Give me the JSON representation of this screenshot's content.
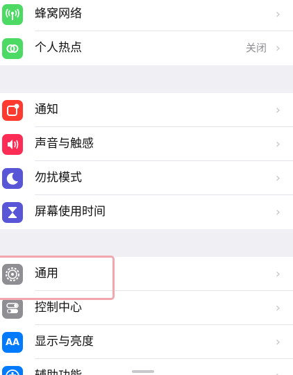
{
  "group1": {
    "items": [
      {
        "label": "蜂窝网络",
        "value": "",
        "icon": "cellular-antenna-icon",
        "color": "#4cd964"
      },
      {
        "label": "个人热点",
        "value": "关闭",
        "icon": "personal-hotspot-icon",
        "color": "#4cd964"
      }
    ]
  },
  "group2": {
    "items": [
      {
        "label": "通知",
        "icon": "notifications-icon",
        "color": "#ff3b30"
      },
      {
        "label": "声音与触感",
        "icon": "speaker-icon",
        "color": "#ff2d55"
      },
      {
        "label": "勿扰模式",
        "icon": "moon-icon",
        "color": "#5856d6"
      },
      {
        "label": "屏幕使用时间",
        "icon": "hourglass-icon",
        "color": "#5856d6"
      }
    ]
  },
  "group3": {
    "items": [
      {
        "label": "通用",
        "icon": "gear-icon",
        "color": "#8e8e93"
      },
      {
        "label": "控制中心",
        "icon": "toggles-icon",
        "color": "#8e8e93"
      },
      {
        "label": "显示与亮度",
        "icon": "text-size-aa-icon",
        "color": "#007aff"
      },
      {
        "label": "辅助功能",
        "icon": "accessibility-icon",
        "color": "#007aff"
      }
    ]
  },
  "icon_text": {
    "aa": "AA"
  },
  "chevron": "›",
  "highlight": {
    "target": "通用",
    "color": "#f2a7ae"
  }
}
